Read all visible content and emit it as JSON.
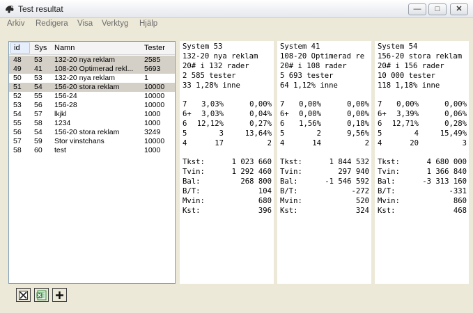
{
  "window": {
    "title": "Test resultat"
  },
  "menu": [
    "Arkiv",
    "Redigera",
    "Visa",
    "Verktyg",
    "Hjälp"
  ],
  "list": {
    "headers": {
      "id": "id",
      "sys": "Sys",
      "namn": "Namn",
      "tester": "Tester"
    },
    "rows": [
      {
        "id": "48",
        "sys": "53",
        "namn": "132-20 nya reklam",
        "tester": "2585",
        "selected": true
      },
      {
        "id": "49",
        "sys": "41",
        "namn": "108-20 Optimerad rekl...",
        "tester": "5693",
        "selected": true
      },
      {
        "id": "50",
        "sys": "53",
        "namn": "132-20 nya reklam",
        "tester": "1",
        "selected": false
      },
      {
        "id": "51",
        "sys": "54",
        "namn": "156-20 stora reklam",
        "tester": "10000",
        "selected": true
      },
      {
        "id": "52",
        "sys": "55",
        "namn": "156-24",
        "tester": "10000",
        "selected": false
      },
      {
        "id": "53",
        "sys": "56",
        "namn": "156-28",
        "tester": "10000",
        "selected": false
      },
      {
        "id": "54",
        "sys": "57",
        "namn": "lkjkl",
        "tester": "1000",
        "selected": false
      },
      {
        "id": "55",
        "sys": "58",
        "namn": "1234",
        "tester": "1000",
        "selected": false
      },
      {
        "id": "56",
        "sys": "54",
        "namn": "156-20 stora reklam",
        "tester": "3249",
        "selected": false
      },
      {
        "id": "57",
        "sys": "59",
        "namn": "Stor vinstchans",
        "tester": "10000",
        "selected": false
      },
      {
        "id": "58",
        "sys": "60",
        "namn": "test",
        "tester": "1000",
        "selected": false
      }
    ]
  },
  "systems": [
    {
      "header": [
        "System 53",
        "132-20 nya reklam",
        "20# i 132 rader",
        "2 585 tester",
        "33 1,28% inne"
      ],
      "odds": [
        [
          "7",
          "3,03%",
          "0,00%"
        ],
        [
          "6+",
          "3,03%",
          "0,04%"
        ],
        [
          "6",
          "12,12%",
          "0,27%"
        ],
        [
          "5",
          "3",
          "13,64%"
        ],
        [
          "4",
          "17",
          "2"
        ]
      ],
      "stats": [
        [
          "Tkst:",
          "1 023 660"
        ],
        [
          "Tvin:",
          "1 292 460"
        ],
        [
          "Bal:",
          "268 800"
        ],
        [
          "B/T:",
          "104"
        ],
        [
          "Mvin:",
          "680"
        ],
        [
          "Kst:",
          "396"
        ]
      ]
    },
    {
      "header": [
        "System 41",
        "108-20 Optimerad re",
        "20# i 108 rader",
        "5 693 tester",
        "64 1,12% inne"
      ],
      "odds": [
        [
          "7",
          "0,00%",
          "0,00%"
        ],
        [
          "6+",
          "0,00%",
          "0,00%"
        ],
        [
          "6",
          "1,56%",
          "0,18%"
        ],
        [
          "5",
          "2",
          "9,56%"
        ],
        [
          "4",
          "14",
          "2"
        ]
      ],
      "stats": [
        [
          "Tkst:",
          "1 844 532"
        ],
        [
          "Tvin:",
          "297 940"
        ],
        [
          "Bal:",
          "-1 546 592"
        ],
        [
          "B/T:",
          "-272"
        ],
        [
          "Mvin:",
          "520"
        ],
        [
          "Kst:",
          "324"
        ]
      ]
    },
    {
      "header": [
        "System 54",
        "156-20 stora reklam",
        "20# i 156 rader",
        "10 000 tester",
        "118 1,18% inne"
      ],
      "odds": [
        [
          "7",
          "0,00%",
          "0,00%"
        ],
        [
          "6+",
          "3,39%",
          "0,06%"
        ],
        [
          "6",
          "12,71%",
          "0,28%"
        ],
        [
          "5",
          "4",
          "15,49%"
        ],
        [
          "4",
          "20",
          "3"
        ]
      ],
      "stats": [
        [
          "Tkst:",
          "4 680 000"
        ],
        [
          "Tvin:",
          "1 366 840"
        ],
        [
          "Bal:",
          "-3 313 160"
        ],
        [
          "B/T:",
          "-331"
        ],
        [
          "Mvin:",
          "860"
        ],
        [
          "Kst:",
          "468"
        ]
      ]
    }
  ],
  "toolbar": [
    {
      "name": "close-tool-button",
      "icon": "close-icon"
    },
    {
      "name": "excel-export-button",
      "icon": "excel-icon"
    },
    {
      "name": "add-button",
      "icon": "plus-icon"
    }
  ],
  "colors": {
    "selection": "#d4d0c8",
    "window_bg": "#ece9d8",
    "excel_green": "#2f8a3a"
  }
}
